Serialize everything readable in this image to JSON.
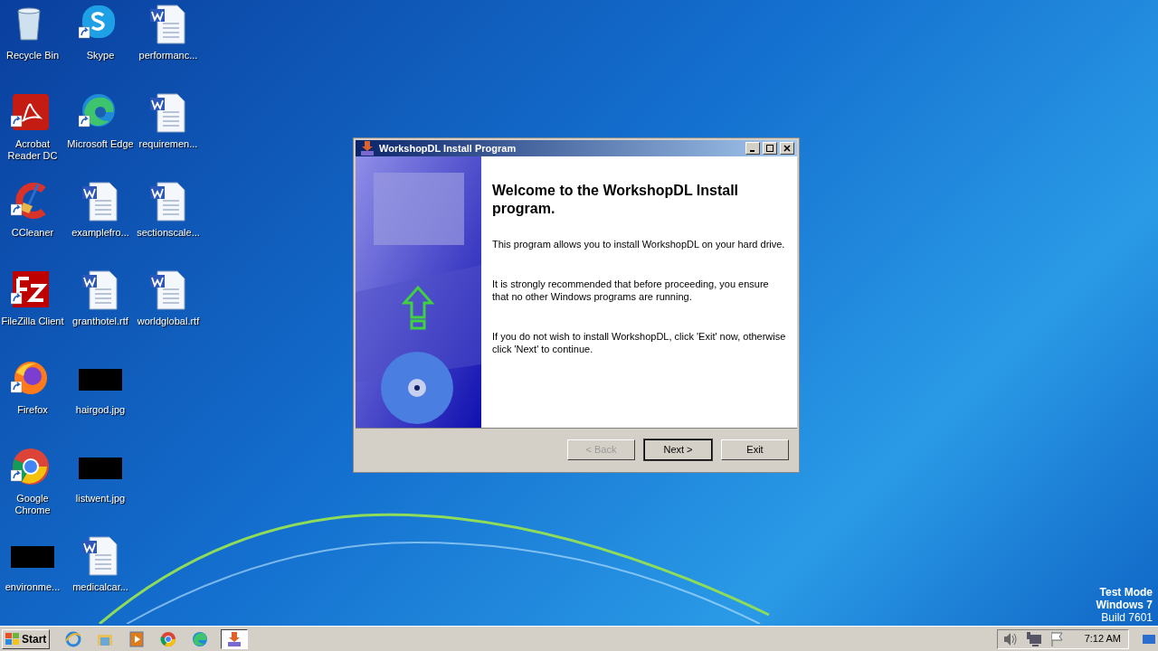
{
  "desktop": {
    "icons": [
      {
        "label": "Recycle Bin",
        "kind": "recycle",
        "shortcut": false
      },
      {
        "label": "Acrobat Reader DC",
        "kind": "acrobat",
        "shortcut": true
      },
      {
        "label": "CCleaner",
        "kind": "ccleaner",
        "shortcut": true
      },
      {
        "label": "FileZilla Client",
        "kind": "filezilla",
        "shortcut": true
      },
      {
        "label": "Firefox",
        "kind": "firefox",
        "shortcut": true
      },
      {
        "label": "Google Chrome",
        "kind": "chrome",
        "shortcut": true
      },
      {
        "label": "environme...",
        "kind": "image",
        "shortcut": false
      },
      {
        "label": "Skype",
        "kind": "skype",
        "shortcut": true
      },
      {
        "label": "Microsoft Edge",
        "kind": "edge",
        "shortcut": true
      },
      {
        "label": "examplefro...",
        "kind": "word",
        "shortcut": false
      },
      {
        "label": "granthotel.rtf",
        "kind": "word",
        "shortcut": false
      },
      {
        "label": "hairgod.jpg",
        "kind": "image",
        "shortcut": false
      },
      {
        "label": "listwent.jpg",
        "kind": "image",
        "shortcut": false
      },
      {
        "label": "medicalcar...",
        "kind": "word",
        "shortcut": false
      },
      {
        "label": "performanc...",
        "kind": "word",
        "shortcut": false
      },
      {
        "label": "requiremen...",
        "kind": "word",
        "shortcut": false
      },
      {
        "label": "sectionscale...",
        "kind": "word",
        "shortcut": false
      },
      {
        "label": "worldglobal.rtf",
        "kind": "word",
        "shortcut": false
      }
    ],
    "watermark_text": [
      "Test Mode",
      "Windows 7",
      "Build 7601"
    ]
  },
  "window": {
    "title": "WorkshopDL Install Program",
    "heading": "Welcome to the WorkshopDL Install program.",
    "paragraphs": [
      "This program allows you to install WorkshopDL on your hard drive.",
      "It is strongly recommended that before proceeding, you ensure that no other Windows programs are running.",
      "If you do not wish to install WorkshopDL, click 'Exit' now, otherwise click 'Next' to continue."
    ],
    "buttons": [
      {
        "label": "< Back",
        "disabled": true,
        "default": false
      },
      {
        "label": "Next >",
        "disabled": false,
        "default": true
      },
      {
        "label": "Exit",
        "disabled": false,
        "default": false
      }
    ]
  },
  "taskbar": {
    "start": "Start",
    "items": [
      {
        "kind": "ie",
        "selected": false
      },
      {
        "kind": "explorer",
        "selected": false
      },
      {
        "kind": "media",
        "selected": false
      },
      {
        "kind": "chrome",
        "selected": false
      },
      {
        "kind": "edge",
        "selected": false
      },
      {
        "kind": "installer",
        "selected": true
      }
    ],
    "tray": [
      {
        "kind": "speaker"
      },
      {
        "kind": "network"
      },
      {
        "kind": "flag"
      }
    ],
    "clock": "7:12 AM"
  }
}
